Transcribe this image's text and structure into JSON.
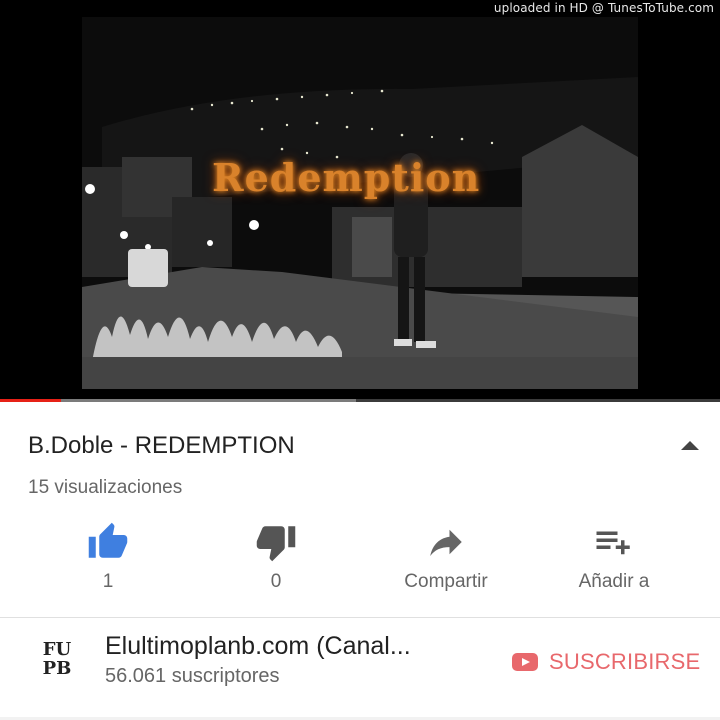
{
  "watermark": "uploaded in HD @ TunesToTube.com",
  "player": {
    "overlay_title": "Redemption",
    "progress_played": 0.085,
    "progress_buffered": 0.495
  },
  "video": {
    "title": "B.Doble - REDEMPTION",
    "views": "15 visualizaciones"
  },
  "actions": [
    {
      "icon": "thumbs-up-icon",
      "label": "1",
      "color": "#3f7fe0"
    },
    {
      "icon": "thumbs-down-icon",
      "label": "0",
      "color": "#555555"
    },
    {
      "icon": "share-icon",
      "label": "Compartir",
      "color": "#666666"
    },
    {
      "icon": "add-to-playlist-icon",
      "label": "Añadir a",
      "color": "#555555"
    }
  ],
  "channel": {
    "logo_text": "FU PB",
    "name": "Elultimoplanb.com (Canal...",
    "subscribers": "56.061 suscriptores"
  },
  "subscribe_label": "SUSCRIBIRSE",
  "colors": {
    "accent_red": "#e62117",
    "subscribe": "#e8686c",
    "like_blue": "#3f7fe0"
  }
}
